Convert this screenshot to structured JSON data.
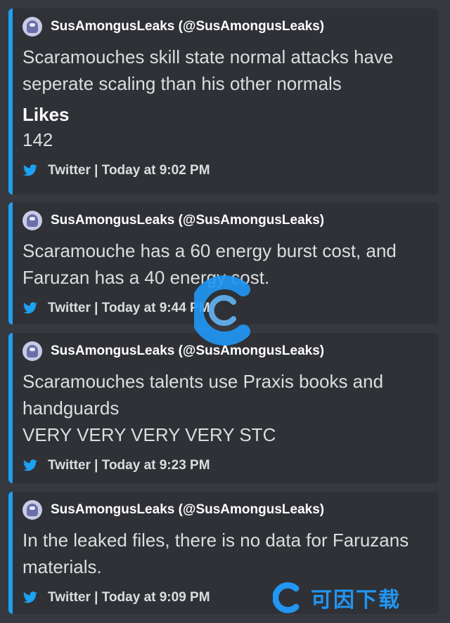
{
  "embeds": [
    {
      "author": "SusAmongusLeaks (@SusAmongusLeaks)",
      "description": "Scaramouches skill state normal attacks have seperate scaling than his other normals",
      "field": {
        "name": "Likes",
        "value": "142"
      },
      "footer": "Twitter | Today at 9:02 PM"
    },
    {
      "author": "SusAmongusLeaks (@SusAmongusLeaks)",
      "description": "Scaramouche has a 60 energy burst cost, and Faruzan has a 40 energy cost.",
      "footer": "Twitter | Today at 9:44 PM"
    },
    {
      "author": "SusAmongusLeaks (@SusAmongusLeaks)",
      "description_lines": [
        "Scaramouches talents use Praxis books and handguards",
        "VERY VERY VERY VERY STC"
      ],
      "footer": "Twitter | Today at 9:23 PM"
    },
    {
      "author": "SusAmongusLeaks (@SusAmongusLeaks)",
      "description": "In the leaked files, there is no data for Faruzans materials.",
      "footer": "Twitter | Today at 9:09 PM"
    }
  ],
  "icons": {
    "footer": "twitter-bird-icon",
    "avatar": "avatar-icon"
  },
  "colors": {
    "accent": "#1da1f2",
    "background": "#36393f",
    "embed_bg": "#2f3136"
  },
  "watermark": {
    "text": "可因下载"
  }
}
